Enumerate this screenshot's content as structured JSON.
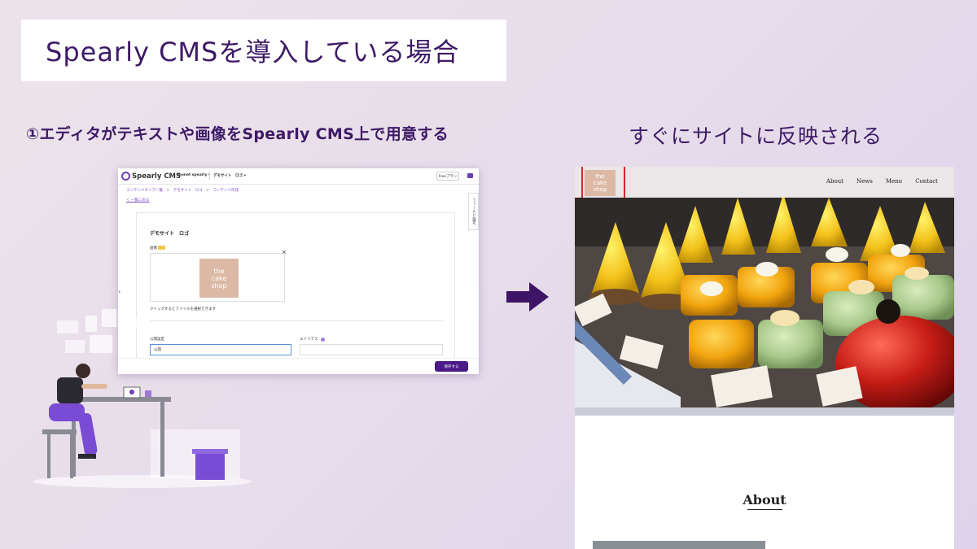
{
  "title": "Spearly CMSを導入している場合",
  "step_label": "①エディタがテキストや画像をSpearly CMS上で用意する",
  "result_label": "すぐにサイトに反映される",
  "cms": {
    "logo_text": "Spearly CMS",
    "team": "monet spearly ▾",
    "content_type": "デモサイト　ロゴ ▾",
    "plan_button": "Freeプラン",
    "breadcrumb": "コンテンツタイプ一覧　>　デモサイト　ロゴ　>　コンテンツ作成",
    "back_link": "＜ 一覧に戻る",
    "side_tab": "フィールド設定",
    "card_title": "デモサイト　ロゴ",
    "image_label": "画像",
    "image_close": "×",
    "thumb_lines": [
      "the",
      "cake",
      "shop"
    ],
    "drop_hint": "クリックするとファイルを選択できます",
    "status_label": "公開設定",
    "status_value": "公開",
    "alias_label": "エイリアス",
    "save_button": "保存する",
    "chevron": "›",
    "accent_color": "#4a1a8a"
  },
  "site": {
    "logo_lines": [
      "the",
      "cake",
      "shop"
    ],
    "nav": [
      "About",
      "News",
      "Menu",
      "Contact"
    ],
    "about_heading": "About",
    "highlight_color": "#d8282e",
    "logo_color": "#dcb9a5"
  }
}
